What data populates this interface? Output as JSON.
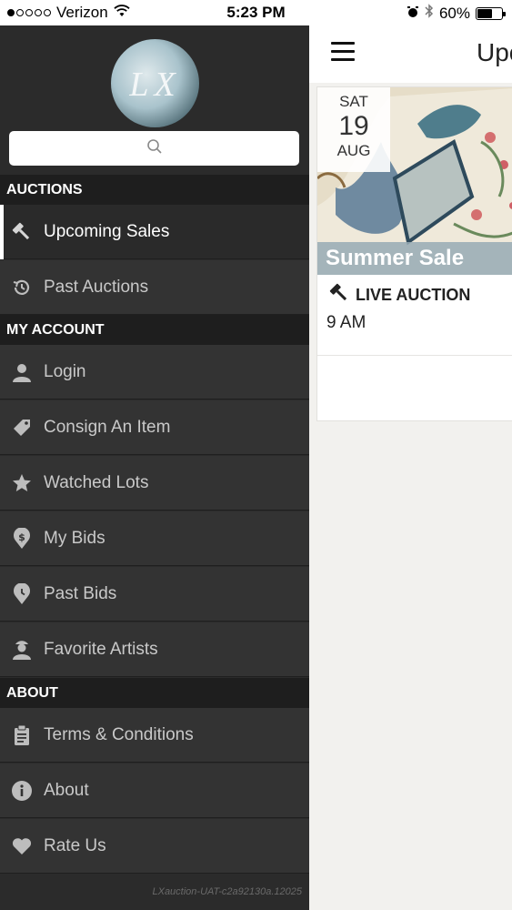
{
  "status_bar": {
    "carrier": "Verizon",
    "time": "5:23 PM",
    "battery": "60%",
    "battery_level": 0.6,
    "signal_dots_filled": 1,
    "signal_dots_total": 5
  },
  "sidebar": {
    "logo_text": "LX",
    "search_icon": "search-icon",
    "sections": [
      {
        "title": "AUCTIONS"
      },
      {
        "title": "MY ACCOUNT"
      },
      {
        "title": "ABOUT"
      }
    ],
    "items": [
      {
        "label": "Upcoming Sales",
        "icon": "gavel-icon",
        "active": true
      },
      {
        "label": "Past Auctions",
        "icon": "history-icon"
      },
      {
        "label": "Login",
        "icon": "user-icon"
      },
      {
        "label": "Consign An Item",
        "icon": "tag-icon"
      },
      {
        "label": "Watched Lots",
        "icon": "star-icon"
      },
      {
        "label": "My Bids",
        "icon": "dollar-pin-icon"
      },
      {
        "label": "Past Bids",
        "icon": "history-pin-icon"
      },
      {
        "label": "Favorite Artists",
        "icon": "artist-icon"
      },
      {
        "label": "Terms & Conditions",
        "icon": "clipboard-icon"
      },
      {
        "label": "About",
        "icon": "info-icon"
      },
      {
        "label": "Rate Us",
        "icon": "heart-icon"
      }
    ],
    "version": "LXauction-UAT-c2a92130a.12025"
  },
  "main": {
    "title": "Upc",
    "card": {
      "day_of_week": "SAT",
      "day": "19",
      "month": "AUG",
      "sale_name": "Summer Sale",
      "auction_type": "LIVE AUCTION",
      "time": "9 AM"
    }
  },
  "colors": {
    "sidebar_bg": "#2b2b2b",
    "section_bg": "#1e1e1e",
    "item_bg": "#333333",
    "main_bg": "#f2f1ee"
  }
}
